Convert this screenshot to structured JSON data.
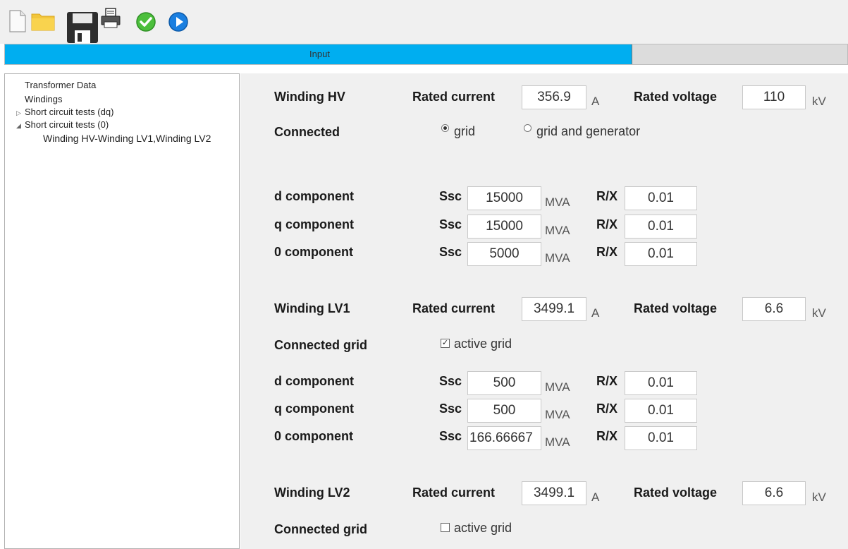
{
  "toolbar": {
    "icons": [
      "new-document-icon",
      "open-folder-icon",
      "save-disk-icon",
      "print-icon",
      "validate-check-icon",
      "run-play-icon"
    ]
  },
  "progress": {
    "label": "Input",
    "fraction": 0.745,
    "color": "#00aef0"
  },
  "tree": {
    "items": [
      {
        "label": "Transformer Data",
        "arrow": ""
      },
      {
        "label": "Windings",
        "arrow": ""
      },
      {
        "label": "Short circuit tests (dq)",
        "arrow": "▷"
      },
      {
        "label": "Short circuit tests (0)",
        "arrow": "◢"
      },
      {
        "label": "Winding HV-Winding LV1,Winding LV2",
        "arrow": ""
      }
    ]
  },
  "labels": {
    "rated_current": "Rated current",
    "rated_voltage": "Rated voltage",
    "ssc": "Ssc",
    "rx": "R/X",
    "unit_a": "A",
    "unit_kv": "kV",
    "unit_mva": "MVA",
    "d_component": "d component",
    "q_component": "q component",
    "zero_component": "0 component"
  },
  "hv": {
    "title": "Winding HV",
    "rated_current": "356.9",
    "rated_voltage": "110",
    "connected_label": "Connected",
    "radio_grid": "grid",
    "radio_grid_gen": "grid and generator",
    "d_ssc": "15000",
    "d_rx": "0.01",
    "q_ssc": "15000",
    "q_rx": "0.01",
    "z_ssc": "5000",
    "z_rx": "0.01"
  },
  "lv1": {
    "title": "Winding LV1",
    "rated_current": "3499.1",
    "rated_voltage": "6.6",
    "connected_label": "Connected grid",
    "active_grid": "active grid",
    "active_checked": true,
    "d_ssc": "500",
    "d_rx": "0.01",
    "q_ssc": "500",
    "q_rx": "0.01",
    "z_ssc": "166.66667",
    "z_rx": "0.01"
  },
  "lv2": {
    "title": "Winding LV2",
    "rated_current": "3499.1",
    "rated_voltage": "6.6",
    "connected_label": "Connected grid",
    "active_grid": "active grid",
    "active_checked": false
  }
}
